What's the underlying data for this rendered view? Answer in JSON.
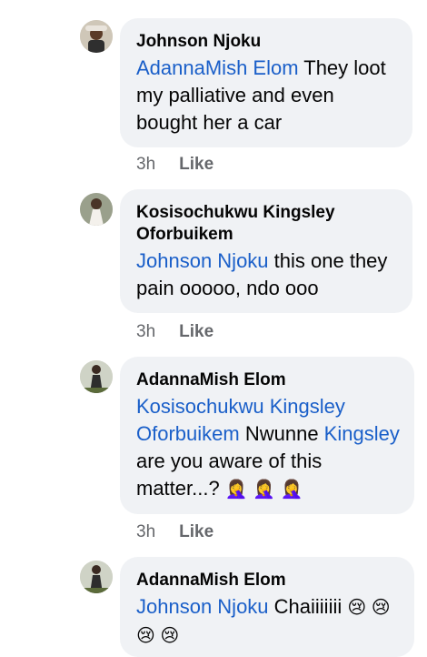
{
  "comments": [
    {
      "author": "Johnson Njoku",
      "mention": "AdannaMish Elom",
      "text": " They loot my palliative and even bought her a car",
      "time": "3h",
      "like": "Like"
    },
    {
      "author": "Kosisochukwu Kingsley Oforbuikem",
      "mention": "Johnson Njoku",
      "text": " this one they pain ooooo, ndo ooo",
      "time": "3h",
      "like": "Like"
    },
    {
      "author": "AdannaMish Elom",
      "mention": "Kosisochukwu Kingsley Oforbuikem",
      "text1": " Nwunne ",
      "mention2": "Kingsley",
      "text2": " are you aware of this matter...? ",
      "emojis": "🤦‍♀️ 🤦‍♀️ 🤦‍♀️",
      "time": "3h",
      "like": "Like"
    },
    {
      "author": "AdannaMish Elom",
      "mention": "Johnson Njoku",
      "text": " Chaiiiiiii ",
      "emojis": "😢 😢 😢 😢"
    }
  ]
}
